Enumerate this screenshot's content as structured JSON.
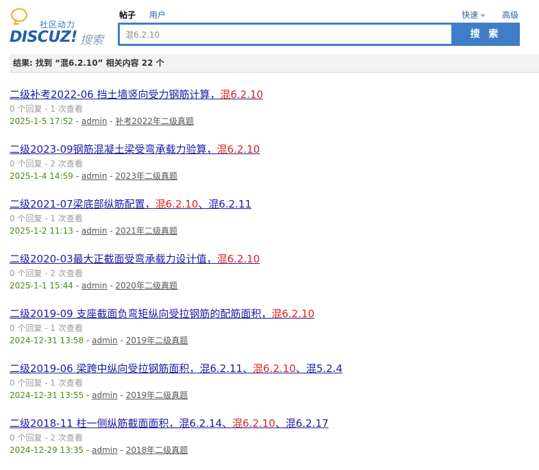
{
  "logo": {
    "slogan": "社区动力",
    "brand": "DISCUZ!",
    "sub": "搜索"
  },
  "tabs": [
    {
      "label": "帖子",
      "active": true
    },
    {
      "label": "用户",
      "active": false
    }
  ],
  "links": {
    "quick": "快速",
    "advanced": "高级"
  },
  "search": {
    "value": "混6.2.10",
    "button": "搜 索"
  },
  "result_summary": "结果: 找到 “混6.2.10” 相关内容 22 个",
  "results": [
    {
      "title_parts": [
        {
          "text": "二级补考2022-06 挡土墙竖向受力钢筋计算，",
          "hl": false
        },
        {
          "text": "混6.2.10",
          "hl": true
        }
      ],
      "stats": "0 个回复 - 1 次查看",
      "date": "2025-1-5 17:52",
      "author": "admin",
      "forum": "补考2022年二级真题"
    },
    {
      "title_parts": [
        {
          "text": "二级2023-09钢筋混凝土梁受弯承载力验算，",
          "hl": false
        },
        {
          "text": "混6.2.10",
          "hl": true
        }
      ],
      "stats": "0 个回复 - 2 次查看",
      "date": "2025-1-4 14:59",
      "author": "admin",
      "forum": "2023年二级真题"
    },
    {
      "title_parts": [
        {
          "text": "二级2021-07梁底部纵筋配置，",
          "hl": false
        },
        {
          "text": "混6.2.10",
          "hl": true
        },
        {
          "text": "、混6.2.11",
          "hl": false
        }
      ],
      "stats": "0 个回复 - 1 次查看",
      "date": "2025-1-2 11:13",
      "author": "admin",
      "forum": "2021年二级真题"
    },
    {
      "title_parts": [
        {
          "text": "二级2020-03最大正截面受弯承载力设计值，",
          "hl": false
        },
        {
          "text": "混6.2.10",
          "hl": true
        }
      ],
      "stats": "0 个回复 - 2 次查看",
      "date": "2025-1-1 15:44",
      "author": "admin",
      "forum": "2020年二级真题"
    },
    {
      "title_parts": [
        {
          "text": "二级2019-09 支座截面负弯矩纵向受拉钢筋的配筋面积，",
          "hl": false
        },
        {
          "text": "混6.2.10",
          "hl": true
        }
      ],
      "stats": "0 个回复 - 1 次查看",
      "date": "2024-12-31 13:58",
      "author": "admin",
      "forum": "2019年二级真题"
    },
    {
      "title_parts": [
        {
          "text": "二级2019-06 梁跨中纵向受拉钢筋面积，混6.2.11、",
          "hl": false
        },
        {
          "text": "混6.2.10",
          "hl": true
        },
        {
          "text": "、混5.2.4",
          "hl": false
        }
      ],
      "stats": "0 个回复 - 1 次查看",
      "date": "2024-12-31 13:55",
      "author": "admin",
      "forum": "2019年二级真题"
    },
    {
      "title_parts": [
        {
          "text": "二级2018-11 柱一侧纵筋截面面积，混6.2.14、",
          "hl": false
        },
        {
          "text": "混6.2.10",
          "hl": true
        },
        {
          "text": "、混6.2.17",
          "hl": false
        }
      ],
      "stats": "0 个回复 - 2 次查看",
      "date": "2024-12-29 13:35",
      "author": "admin",
      "forum": "2018年二级真题"
    }
  ]
}
